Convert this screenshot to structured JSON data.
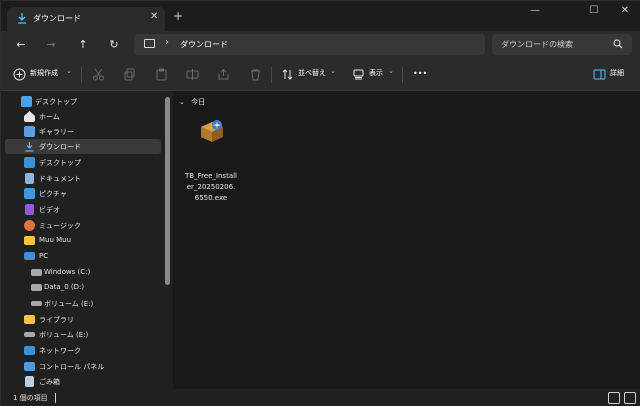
{
  "window": {
    "tab_title": "ダウンロード",
    "tab_close": "✕",
    "new_tab": "+",
    "minimize": "—",
    "maximize": "☐",
    "close": "✕"
  },
  "nav": {
    "back": "←",
    "forward": "→",
    "up": "↑",
    "refresh": "↻",
    "breadcrumb_sep": "›",
    "breadcrumb": "ダウンロード",
    "search_placeholder": "ダウンロードの検索"
  },
  "commands": {
    "new": "新規作成",
    "new_arrow": "⌄",
    "sort": "並べ替え",
    "sort_arrow": "⌄",
    "view": "表示",
    "view_arrow": "⌄",
    "more": "•••",
    "details": "詳細"
  },
  "sidebar": {
    "items": [
      {
        "label": "デスクトップ",
        "icon": "desktop-icon"
      },
      {
        "label": "ホーム",
        "icon": "home-icon"
      },
      {
        "label": "ギャラリー",
        "icon": "gallery-icon"
      },
      {
        "label": "ダウンロード",
        "icon": "download-icon"
      },
      {
        "label": "デスクトップ",
        "icon": "desktop-icon"
      },
      {
        "label": "ドキュメント",
        "icon": "documents-icon"
      },
      {
        "label": "ピクチャ",
        "icon": "pictures-icon"
      },
      {
        "label": "ビデオ",
        "icon": "videos-icon"
      },
      {
        "label": "ミュージック",
        "icon": "music-icon"
      },
      {
        "label": "Muu Muu",
        "icon": "folder-icon"
      },
      {
        "label": "PC",
        "icon": "pc-icon"
      },
      {
        "label": "Windows (C:)",
        "icon": "drive-icon"
      },
      {
        "label": "Data_0 (D:)",
        "icon": "drive-icon"
      },
      {
        "label": "ボリューム (E:)",
        "icon": "drive-icon"
      },
      {
        "label": "ライブラリ",
        "icon": "library-icon"
      },
      {
        "label": "ボリューム (E:)",
        "icon": "drive-icon"
      },
      {
        "label": "ネットワーク",
        "icon": "network-icon"
      },
      {
        "label": "コントロール パネル",
        "icon": "control-panel-icon"
      },
      {
        "label": "ごみ箱",
        "icon": "recycle-bin-icon"
      }
    ]
  },
  "content": {
    "group_chevron": "⌄",
    "group_label": "今日",
    "files": [
      {
        "name": "TB_Free_Installer_20250206.6550.exe",
        "icon": "installer-icon"
      }
    ]
  },
  "status": {
    "text": "1 個の項目"
  },
  "colors": {
    "accent": "#4cc2ff",
    "folder": "#f5c342"
  }
}
